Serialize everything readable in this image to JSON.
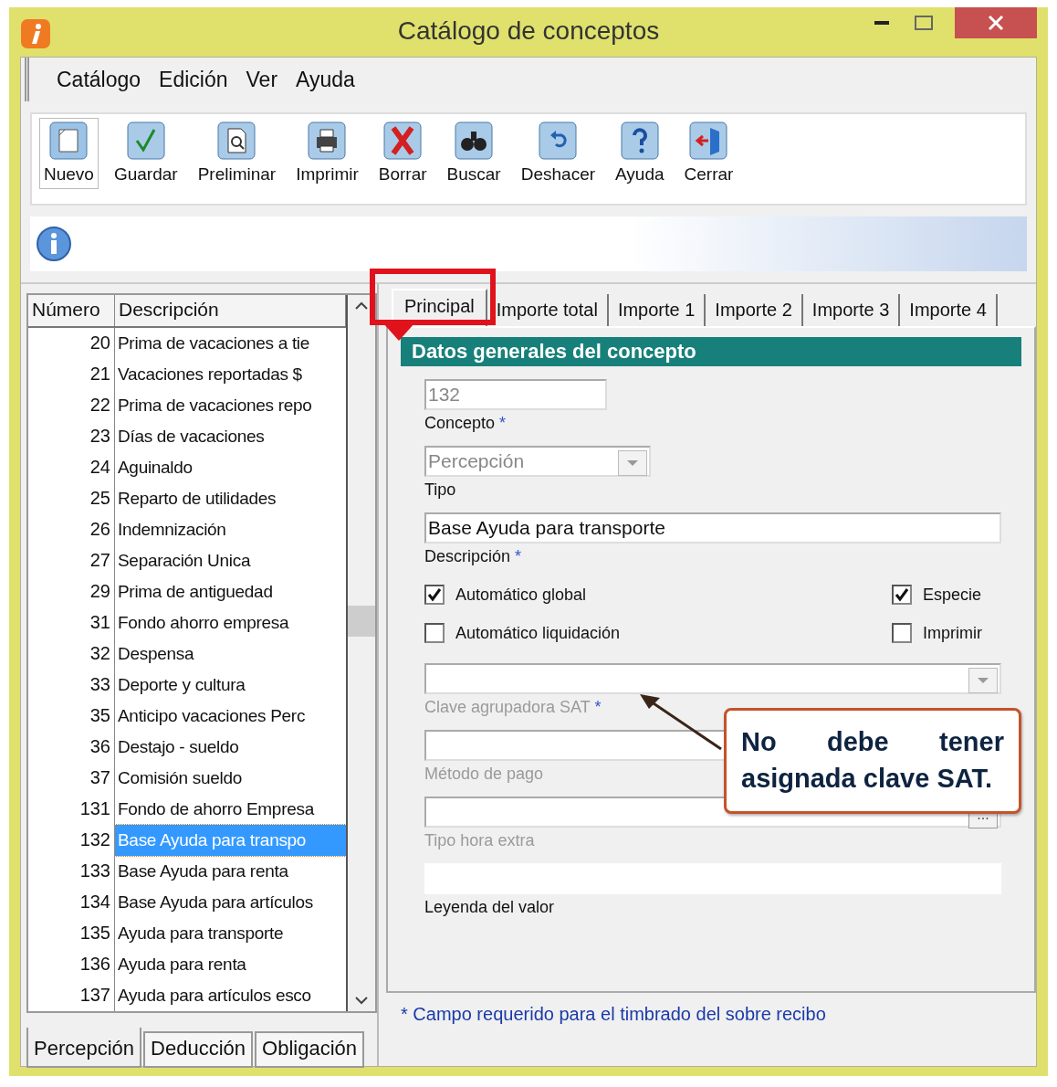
{
  "window": {
    "title": "Catálogo de conceptos"
  },
  "menu": [
    "Catálogo",
    "Edición",
    "Ver",
    "Ayuda"
  ],
  "toolbar": [
    {
      "label": "Nuevo",
      "selected": true
    },
    {
      "label": "Guardar",
      "selected": false
    },
    {
      "label": "Preliminar",
      "selected": false
    },
    {
      "label": "Imprimir",
      "selected": false
    },
    {
      "label": "Borrar",
      "selected": false
    },
    {
      "label": "Buscar",
      "selected": false
    },
    {
      "label": "Deshacer",
      "selected": false
    },
    {
      "label": "Ayuda",
      "selected": false
    },
    {
      "label": "Cerrar",
      "selected": false
    }
  ],
  "list": {
    "columns": [
      "Número",
      "Descripción"
    ],
    "rows": [
      {
        "number": "20",
        "description": "Prima de vacaciones a tie",
        "selected": false
      },
      {
        "number": "21",
        "description": "Vacaciones reportadas $",
        "selected": false
      },
      {
        "number": "22",
        "description": "Prima de vacaciones repo",
        "selected": false
      },
      {
        "number": "23",
        "description": "Días de vacaciones",
        "selected": false
      },
      {
        "number": "24",
        "description": "Aguinaldo",
        "selected": false
      },
      {
        "number": "25",
        "description": "Reparto de utilidades",
        "selected": false
      },
      {
        "number": "26",
        "description": "Indemnización",
        "selected": false
      },
      {
        "number": "27",
        "description": "Separación Unica",
        "selected": false
      },
      {
        "number": "29",
        "description": "Prima de antiguedad",
        "selected": false
      },
      {
        "number": "31",
        "description": "Fondo ahorro empresa",
        "selected": false
      },
      {
        "number": "32",
        "description": "Despensa",
        "selected": false
      },
      {
        "number": "33",
        "description": "Deporte y cultura",
        "selected": false
      },
      {
        "number": "35",
        "description": "Anticipo vacaciones Perc",
        "selected": false
      },
      {
        "number": "36",
        "description": "Destajo - sueldo",
        "selected": false
      },
      {
        "number": "37",
        "description": "Comisión sueldo",
        "selected": false
      },
      {
        "number": "131",
        "description": "Fondo de ahorro Empresa",
        "selected": false
      },
      {
        "number": "132",
        "description": "Base Ayuda para transpo",
        "selected": true
      },
      {
        "number": "133",
        "description": "Base Ayuda para renta",
        "selected": false
      },
      {
        "number": "134",
        "description": "Base Ayuda para artículos",
        "selected": false
      },
      {
        "number": "135",
        "description": "Ayuda para transporte",
        "selected": false
      },
      {
        "number": "136",
        "description": "Ayuda para renta",
        "selected": false
      },
      {
        "number": "137",
        "description": "Ayuda para artículos esco",
        "selected": false
      }
    ]
  },
  "bottom_tabs": [
    {
      "label": "Percepción",
      "selected": true
    },
    {
      "label": "Deducción",
      "selected": false
    },
    {
      "label": "Obligación",
      "selected": false
    }
  ],
  "form": {
    "tabs": [
      {
        "label": "Principal",
        "selected": true
      },
      {
        "label": "Importe total",
        "selected": false
      },
      {
        "label": "Importe 1",
        "selected": false
      },
      {
        "label": "Importe 2",
        "selected": false
      },
      {
        "label": "Importe 3",
        "selected": false
      },
      {
        "label": "Importe 4",
        "selected": false
      }
    ],
    "section_title": "Datos generales del concepto",
    "top_fields": [
      {
        "kind": "short",
        "value": "132",
        "label": "Concepto",
        "required_mark": "*",
        "readonly": true
      },
      {
        "kind": "select",
        "value": "Percepción",
        "label": "Tipo",
        "readonly": true
      },
      {
        "kind": "wide",
        "value": "Base Ayuda para transporte",
        "label": "Descripción",
        "required_mark": "*",
        "readonly": false
      }
    ],
    "checkboxes": [
      {
        "label": "Automático global",
        "checked": true
      },
      {
        "label": "Especie",
        "checked": true
      },
      {
        "label": "Automático liquidación",
        "checked": false
      },
      {
        "label": "Imprimir",
        "checked": false
      }
    ],
    "bottom_fields": [
      {
        "kind": "select",
        "label": "Clave agrupadora SAT",
        "required_mark": "*",
        "disabled": true
      },
      {
        "kind": "wide",
        "label": "Método de pago",
        "disabled": true
      },
      {
        "kind": "browse",
        "button": "...",
        "label": "Tipo hora extra",
        "disabled": true
      },
      {
        "kind": "plain",
        "label": "Leyenda del valor",
        "disabled": false
      }
    ]
  },
  "footer_note": "* Campo requerido para el timbrado del sobre recibo",
  "callout": "No debe tener asignada clave SAT."
}
